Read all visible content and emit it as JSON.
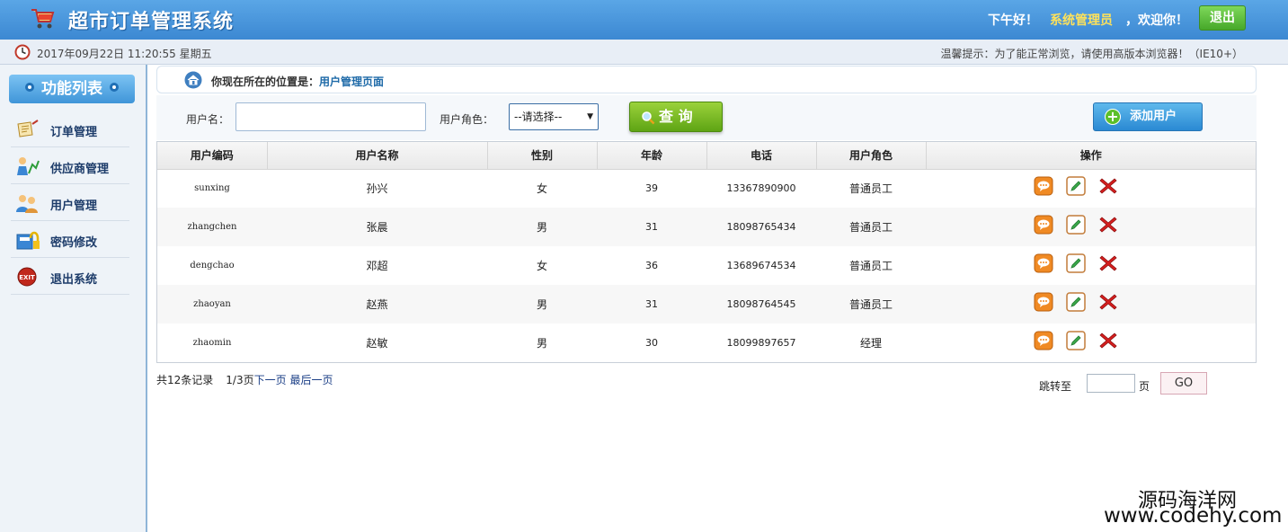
{
  "header": {
    "title": "超市订单管理系统",
    "greeting_prefix": "下午好！",
    "user_name": "系统管理员",
    "greeting_suffix": "，欢迎你！",
    "logout_label": "退出"
  },
  "subbar": {
    "datetime": "2017年09月22日 11:20:55 星期五",
    "tip": "温馨提示：为了能正常浏览，请使用高版本浏览器！（IE10+）"
  },
  "sidebar": {
    "title": "功能列表",
    "items": [
      {
        "label": "订单管理",
        "icon": "order-icon"
      },
      {
        "label": "供应商管理",
        "icon": "supplier-icon"
      },
      {
        "label": "用户管理",
        "icon": "users-icon"
      },
      {
        "label": "密码修改",
        "icon": "password-icon"
      },
      {
        "label": "退出系统",
        "icon": "exit-icon"
      }
    ]
  },
  "breadcrumb": {
    "prefix": "你现在所在的位置是：",
    "current": "用户管理页面"
  },
  "search": {
    "username_label": "用户名：",
    "username_value": "",
    "role_label": "用户角色：",
    "role_selected": "--请选择--",
    "query_label": "查 询",
    "add_label": "添加用户"
  },
  "table": {
    "headers": [
      "用户编码",
      "用户名称",
      "性别",
      "年龄",
      "电话",
      "用户角色",
      "操作"
    ],
    "rows": [
      {
        "code": "sunxing",
        "name": "孙兴",
        "gender": "女",
        "age": "39",
        "phone": "13367890900",
        "role": "普通员工"
      },
      {
        "code": "zhangchen",
        "name": "张晨",
        "gender": "男",
        "age": "31",
        "phone": "18098765434",
        "role": "普通员工"
      },
      {
        "code": "dengchao",
        "name": "邓超",
        "gender": "女",
        "age": "36",
        "phone": "13689674534",
        "role": "普通员工"
      },
      {
        "code": "zhaoyan",
        "name": "赵燕",
        "gender": "男",
        "age": "31",
        "phone": "18098764545",
        "role": "普通员工"
      },
      {
        "code": "zhaomin",
        "name": "赵敏",
        "gender": "男",
        "age": "30",
        "phone": "18099897657",
        "role": "经理"
      }
    ]
  },
  "pager": {
    "total": "共12条记录",
    "page": "1/3页",
    "next": "下一页",
    "last": "最后一页",
    "jump_label": "跳转至",
    "jump_value": "",
    "jump_unit": "页",
    "go_label": "GO"
  },
  "watermark": {
    "line1": "源码海洋网",
    "line2": "www.codehy.com"
  },
  "colors": {
    "header_blue": "#3c88d2",
    "accent_green": "#5ea414",
    "accent_blue": "#2a89d3",
    "user_yellow": "#ffe25a"
  }
}
